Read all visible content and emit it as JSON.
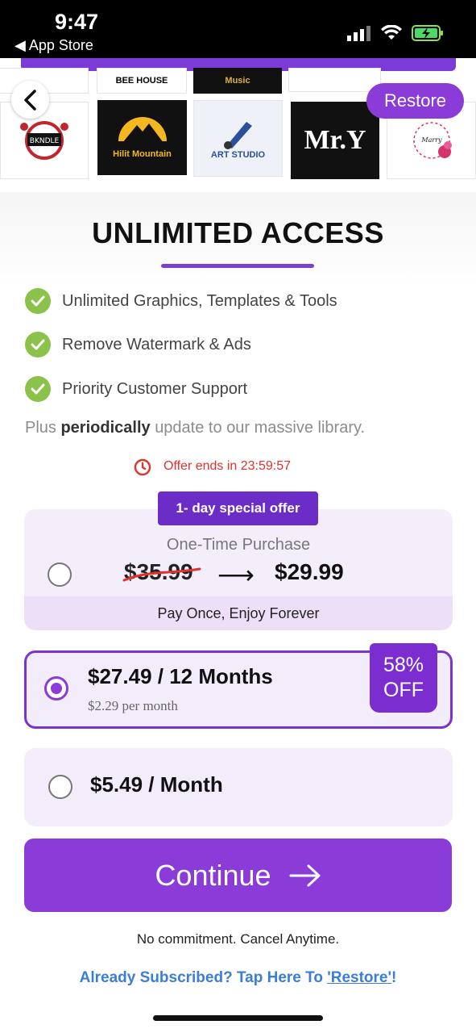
{
  "status": {
    "time": "9:47",
    "back_app": "◀ App Store"
  },
  "header": {
    "restore_label": "Restore"
  },
  "gallery": [
    {
      "name": "BKNDLE Music",
      "dark": false
    },
    {
      "name": "Hilit Mountain",
      "dark": true
    },
    {
      "name": "ART STUDIO",
      "dark": false
    },
    {
      "name": "Mr.Y",
      "dark": true
    },
    {
      "name": "Marrymoman",
      "dark": false
    },
    {
      "name": "BEE HOUSE",
      "dark": false
    },
    {
      "name": "Music",
      "dark": true
    }
  ],
  "headline": "UNLIMITED ACCESS",
  "features": [
    "Unlimited Graphics, Templates & Tools",
    "Remove Watermark & Ads",
    "Priority Customer Support"
  ],
  "plus": {
    "prefix": "Plus",
    "bold": "periodically",
    "suffix": "update to our massive library."
  },
  "offer_timer": "Offer ends in 23:59:57",
  "plans": {
    "special_badge": "1- day special offer",
    "one_time": {
      "title": "One-Time Purchase",
      "old_price": "$35.99",
      "new_price": "$29.99",
      "footer": "Pay Once, Enjoy Forever",
      "selected": false
    },
    "yearly": {
      "price": "$27.49 / 12 Months",
      "sub": "$2.29 per month",
      "badge_line1": "58%",
      "badge_line2": "OFF",
      "selected": true
    },
    "monthly": {
      "price": "$5.49 / Month",
      "selected": false
    }
  },
  "continue_label": "Continue",
  "no_commitment": "No commitment. Cancel Anytime.",
  "already": {
    "text": "Already Subscribed? Tap Here To ",
    "link": "'Restore'",
    "end": "!"
  },
  "colors": {
    "accent": "#8a3bd8",
    "check": "#8bc34a",
    "timer": "#e0332d",
    "link": "#3b7ed6"
  }
}
